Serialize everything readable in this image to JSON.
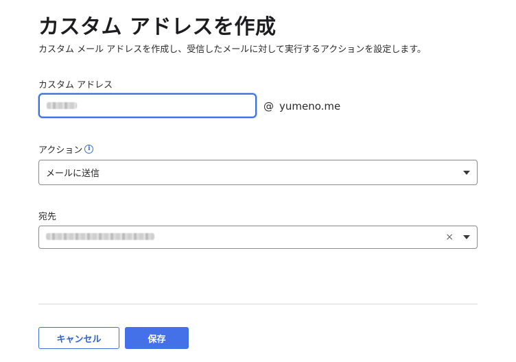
{
  "header": {
    "title": "カスタム アドレスを作成",
    "subtitle": "カスタム メール アドレスを作成し、受信したメールに対して実行するアクションを設定します。"
  },
  "custom_address": {
    "label": "カスタム アドレス",
    "at_symbol": "@",
    "domain": "yumeno.me"
  },
  "action": {
    "label": "アクション",
    "selected": "メールに送信"
  },
  "destination": {
    "label": "宛先",
    "clear_symbol": "×"
  },
  "buttons": {
    "cancel": "キャンセル",
    "save": "保存"
  },
  "colors": {
    "accent": "#4470e8",
    "focus_border": "#3b6fd9"
  }
}
